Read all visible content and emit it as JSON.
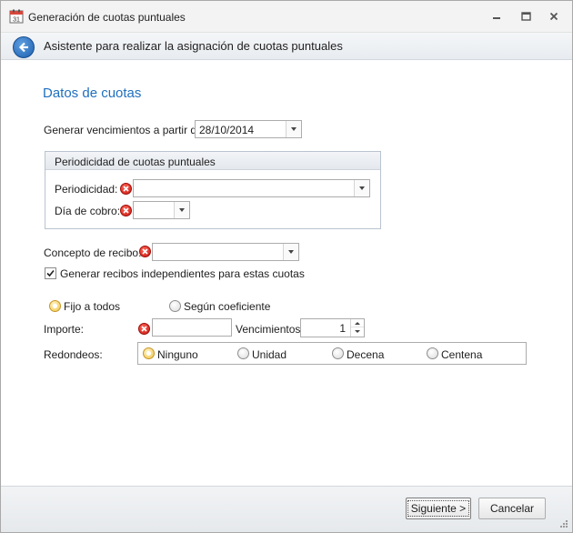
{
  "window": {
    "title": "Generación de cuotas puntuales"
  },
  "header": {
    "title": "Asistente para realizar la asignación de cuotas puntuales"
  },
  "section": {
    "title": "Datos de cuotas"
  },
  "vencimientos": {
    "label": "Generar vencimientos a partir de:",
    "value": "28/10/2014"
  },
  "periodicidad_group": {
    "title": "Periodicidad de cuotas puntuales",
    "periodicidad_label": "Periodicidad:",
    "periodicidad_value": "",
    "dia_label": "Día de cobro:",
    "dia_value": ""
  },
  "concepto": {
    "label": "Concepto de recibo:",
    "value": ""
  },
  "independientes": {
    "label": "Generar recibos independientes para estas cuotas",
    "checked": true
  },
  "modo": {
    "options": [
      {
        "label": "Fijo a todos",
        "selected": true
      },
      {
        "label": "Según coeficiente",
        "selected": false
      }
    ]
  },
  "importe": {
    "label": "Importe:",
    "value": ""
  },
  "num_vencimientos": {
    "label": "Vencimientos:",
    "value": "1"
  },
  "redondeos": {
    "label": "Redondeos:",
    "options": [
      {
        "label": "Ninguno",
        "selected": true
      },
      {
        "label": "Unidad",
        "selected": false
      },
      {
        "label": "Decena",
        "selected": false
      },
      {
        "label": "Centena",
        "selected": false
      }
    ]
  },
  "footer": {
    "next_label": "Siguiente >",
    "cancel_label": "Cancelar"
  }
}
